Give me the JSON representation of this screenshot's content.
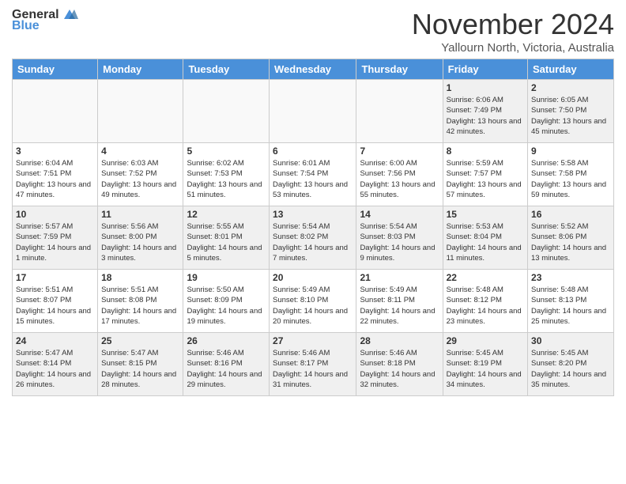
{
  "header": {
    "logo_general": "General",
    "logo_blue": "Blue",
    "month_year": "November 2024",
    "location": "Yallourn North, Victoria, Australia"
  },
  "weekdays": [
    "Sunday",
    "Monday",
    "Tuesday",
    "Wednesday",
    "Thursday",
    "Friday",
    "Saturday"
  ],
  "weeks": [
    [
      {
        "day": "",
        "empty": true
      },
      {
        "day": "",
        "empty": true
      },
      {
        "day": "",
        "empty": true
      },
      {
        "day": "",
        "empty": true
      },
      {
        "day": "",
        "empty": true
      },
      {
        "day": "1",
        "sunrise": "6:06 AM",
        "sunset": "7:49 PM",
        "daylight": "13 hours and 42 minutes."
      },
      {
        "day": "2",
        "sunrise": "6:05 AM",
        "sunset": "7:50 PM",
        "daylight": "13 hours and 45 minutes."
      }
    ],
    [
      {
        "day": "3",
        "sunrise": "6:04 AM",
        "sunset": "7:51 PM",
        "daylight": "13 hours and 47 minutes."
      },
      {
        "day": "4",
        "sunrise": "6:03 AM",
        "sunset": "7:52 PM",
        "daylight": "13 hours and 49 minutes."
      },
      {
        "day": "5",
        "sunrise": "6:02 AM",
        "sunset": "7:53 PM",
        "daylight": "13 hours and 51 minutes."
      },
      {
        "day": "6",
        "sunrise": "6:01 AM",
        "sunset": "7:54 PM",
        "daylight": "13 hours and 53 minutes."
      },
      {
        "day": "7",
        "sunrise": "6:00 AM",
        "sunset": "7:56 PM",
        "daylight": "13 hours and 55 minutes."
      },
      {
        "day": "8",
        "sunrise": "5:59 AM",
        "sunset": "7:57 PM",
        "daylight": "13 hours and 57 minutes."
      },
      {
        "day": "9",
        "sunrise": "5:58 AM",
        "sunset": "7:58 PM",
        "daylight": "13 hours and 59 minutes."
      }
    ],
    [
      {
        "day": "10",
        "sunrise": "5:57 AM",
        "sunset": "7:59 PM",
        "daylight": "14 hours and 1 minute."
      },
      {
        "day": "11",
        "sunrise": "5:56 AM",
        "sunset": "8:00 PM",
        "daylight": "14 hours and 3 minutes."
      },
      {
        "day": "12",
        "sunrise": "5:55 AM",
        "sunset": "8:01 PM",
        "daylight": "14 hours and 5 minutes."
      },
      {
        "day": "13",
        "sunrise": "5:54 AM",
        "sunset": "8:02 PM",
        "daylight": "14 hours and 7 minutes."
      },
      {
        "day": "14",
        "sunrise": "5:54 AM",
        "sunset": "8:03 PM",
        "daylight": "14 hours and 9 minutes."
      },
      {
        "day": "15",
        "sunrise": "5:53 AM",
        "sunset": "8:04 PM",
        "daylight": "14 hours and 11 minutes."
      },
      {
        "day": "16",
        "sunrise": "5:52 AM",
        "sunset": "8:06 PM",
        "daylight": "14 hours and 13 minutes."
      }
    ],
    [
      {
        "day": "17",
        "sunrise": "5:51 AM",
        "sunset": "8:07 PM",
        "daylight": "14 hours and 15 minutes."
      },
      {
        "day": "18",
        "sunrise": "5:51 AM",
        "sunset": "8:08 PM",
        "daylight": "14 hours and 17 minutes."
      },
      {
        "day": "19",
        "sunrise": "5:50 AM",
        "sunset": "8:09 PM",
        "daylight": "14 hours and 19 minutes."
      },
      {
        "day": "20",
        "sunrise": "5:49 AM",
        "sunset": "8:10 PM",
        "daylight": "14 hours and 20 minutes."
      },
      {
        "day": "21",
        "sunrise": "5:49 AM",
        "sunset": "8:11 PM",
        "daylight": "14 hours and 22 minutes."
      },
      {
        "day": "22",
        "sunrise": "5:48 AM",
        "sunset": "8:12 PM",
        "daylight": "14 hours and 23 minutes."
      },
      {
        "day": "23",
        "sunrise": "5:48 AM",
        "sunset": "8:13 PM",
        "daylight": "14 hours and 25 minutes."
      }
    ],
    [
      {
        "day": "24",
        "sunrise": "5:47 AM",
        "sunset": "8:14 PM",
        "daylight": "14 hours and 26 minutes."
      },
      {
        "day": "25",
        "sunrise": "5:47 AM",
        "sunset": "8:15 PM",
        "daylight": "14 hours and 28 minutes."
      },
      {
        "day": "26",
        "sunrise": "5:46 AM",
        "sunset": "8:16 PM",
        "daylight": "14 hours and 29 minutes."
      },
      {
        "day": "27",
        "sunrise": "5:46 AM",
        "sunset": "8:17 PM",
        "daylight": "14 hours and 31 minutes."
      },
      {
        "day": "28",
        "sunrise": "5:46 AM",
        "sunset": "8:18 PM",
        "daylight": "14 hours and 32 minutes."
      },
      {
        "day": "29",
        "sunrise": "5:45 AM",
        "sunset": "8:19 PM",
        "daylight": "14 hours and 34 minutes."
      },
      {
        "day": "30",
        "sunrise": "5:45 AM",
        "sunset": "8:20 PM",
        "daylight": "14 hours and 35 minutes."
      }
    ]
  ]
}
